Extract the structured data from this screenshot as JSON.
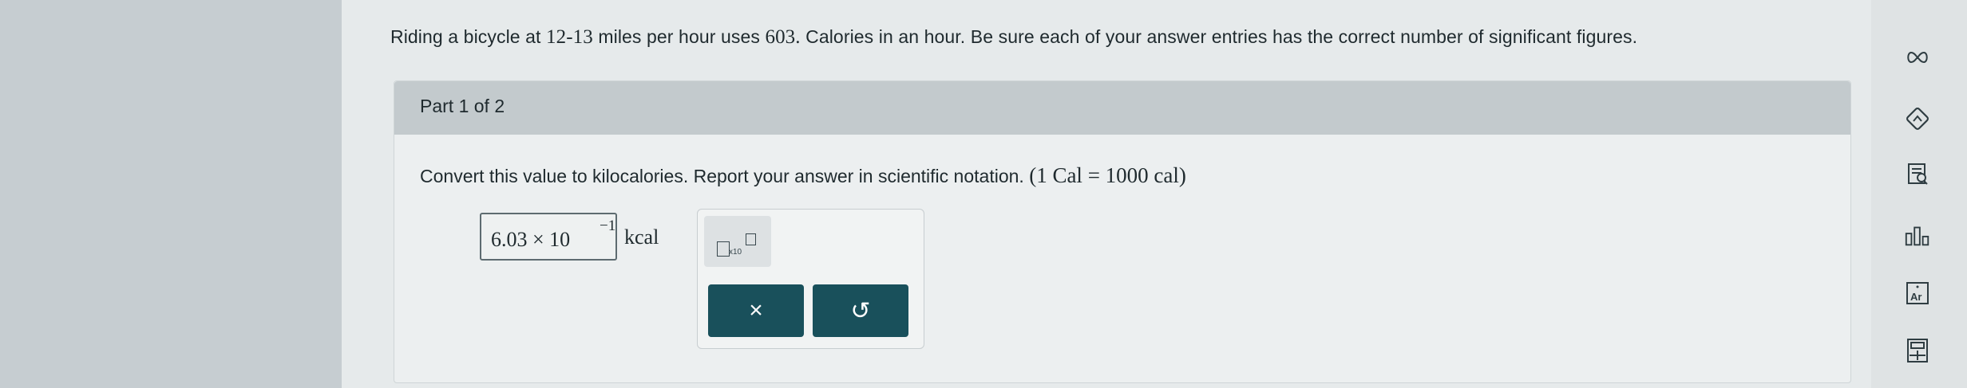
{
  "question": {
    "prefix": "Riding a bicycle at ",
    "speed": "12-13",
    "middle": " miles per hour uses ",
    "calories": "603.",
    "suffix": " Calories in an hour. Be sure each of your answer entries has the correct number of significant figures."
  },
  "part": {
    "label": "Part 1 of 2",
    "instruction": "Convert this value to kilocalories. Report your answer in scientific notation. ",
    "conversion": "(1 Cal = 1000 cal)"
  },
  "answer": {
    "mantissa": "6.03 × 10",
    "exponent": "−1",
    "unit": "kcal"
  },
  "palette": {
    "sci_label": "x10",
    "clear_symbol": "×",
    "undo_symbol": "↺"
  },
  "tools": [
    "infinity-icon",
    "explanation-icon",
    "reference-icon",
    "chart-icon",
    "periodic-table-icon",
    "calculator-icon"
  ],
  "colors": {
    "accent": "#19505b",
    "header": "#c3cacd",
    "background": "#e6eaeb"
  }
}
